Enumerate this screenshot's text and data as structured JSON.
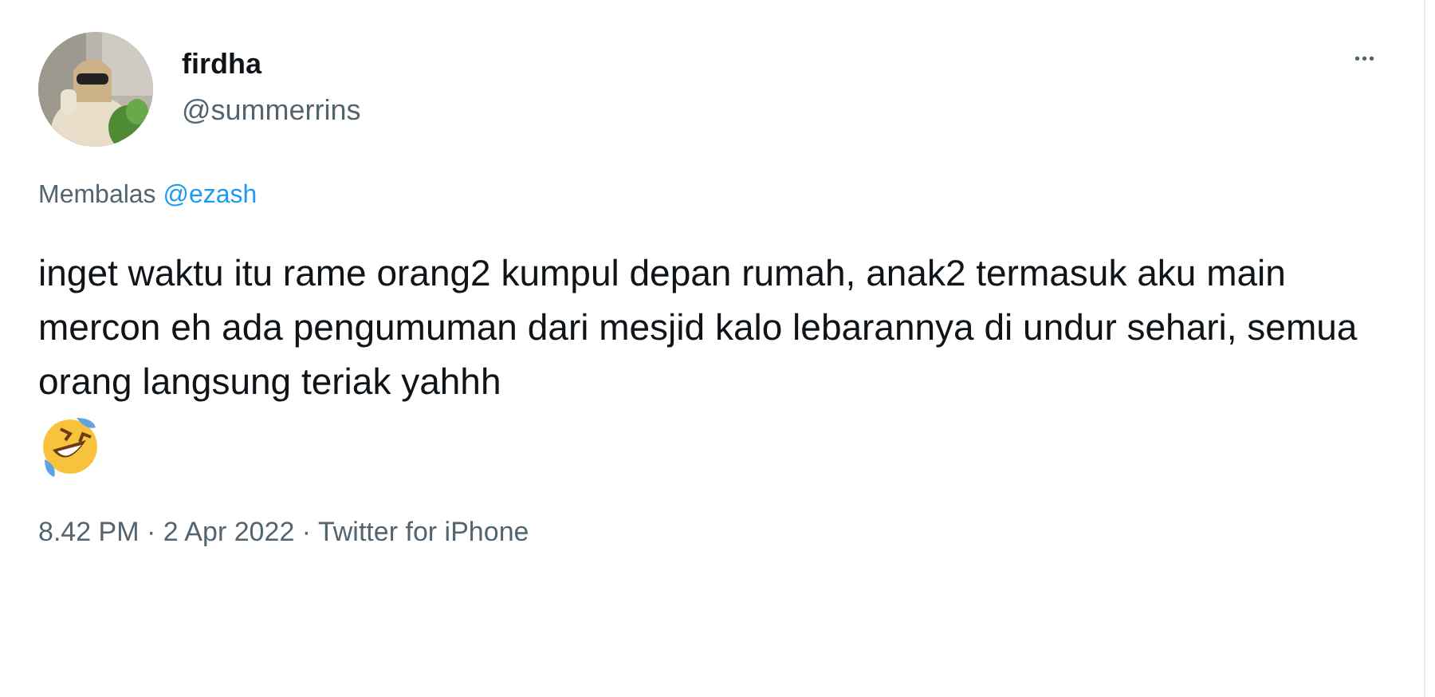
{
  "author": {
    "name": "firdha",
    "handle": "@summerrins"
  },
  "more_button": {
    "label": "•••"
  },
  "reply_to": {
    "prefix": "Membalas",
    "mention": "@ezash"
  },
  "text": "inget waktu itu rame orang2 kumpul depan rumah, anak2 termasuk aku main mercon eh ada pengumuman dari mesjid kalo lebarannya di undur sehari, semua orang langsung teriak yahhh",
  "meta": "8.42 PM · 2 Apr 2022 · Twitter for iPhone"
}
